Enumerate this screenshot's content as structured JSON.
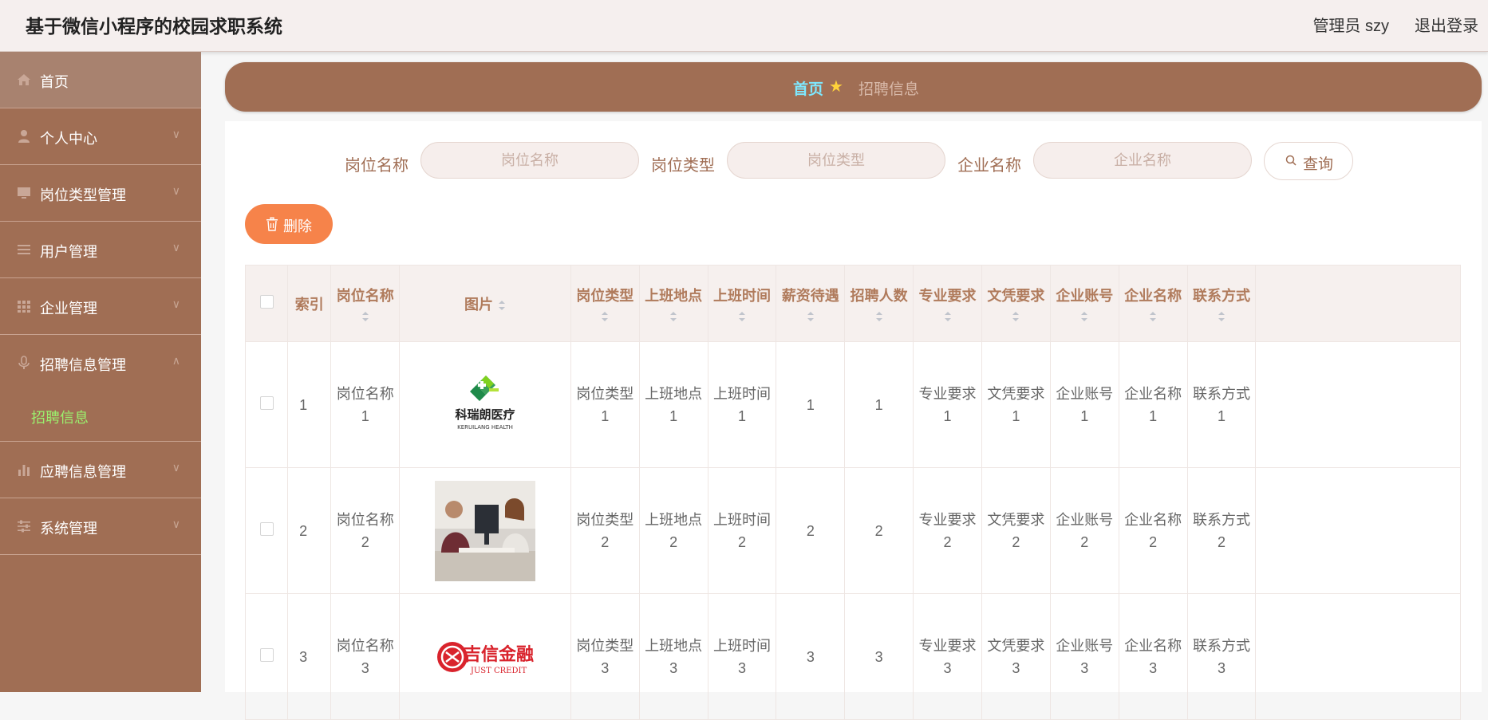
{
  "app": {
    "title": "基于微信小程序的校园求职系统"
  },
  "header": {
    "admin_label": "管理员 szy",
    "logout_label": "退出登录"
  },
  "sidebar": {
    "items": [
      {
        "label": "首页",
        "icon": "home-icon"
      },
      {
        "label": "个人中心",
        "icon": "user-icon"
      },
      {
        "label": "岗位类型管理",
        "icon": "monitor-icon"
      },
      {
        "label": "用户管理",
        "icon": "list-icon"
      },
      {
        "label": "企业管理",
        "icon": "grid-icon"
      },
      {
        "label": "招聘信息管理",
        "icon": "mic-icon"
      },
      {
        "label": "应聘信息管理",
        "icon": "bar-chart-icon"
      },
      {
        "label": "系统管理",
        "icon": "sliders-icon"
      }
    ],
    "submenu": {
      "label": "招聘信息"
    }
  },
  "breadcrumb": {
    "home": "首页",
    "current": "招聘信息"
  },
  "search": {
    "fields": [
      {
        "label": "岗位名称",
        "placeholder": "岗位名称"
      },
      {
        "label": "岗位类型",
        "placeholder": "岗位类型"
      },
      {
        "label": "企业名称",
        "placeholder": "企业名称"
      }
    ],
    "query_label": "查询"
  },
  "toolbar": {
    "delete_label": "删除"
  },
  "table": {
    "columns": [
      "索引",
      "岗位名称",
      "图片",
      "岗位类型",
      "上班地点",
      "上班时间",
      "薪资待遇",
      "招聘人数",
      "专业要求",
      "文凭要求",
      "企业账号",
      "企业名称",
      "联系方式"
    ],
    "rows": [
      {
        "index": "1",
        "job_name": [
          "岗位名称",
          "1"
        ],
        "image": {
          "brand": "科瑞朗医疗",
          "brand_en": "KERUILANG HEALTH"
        },
        "job_type": [
          "岗位类型",
          "1"
        ],
        "location": [
          "上班地点",
          "1"
        ],
        "work_time": [
          "上班时间",
          "1"
        ],
        "salary": "1",
        "headcount": "1",
        "major": [
          "专业要求",
          "1"
        ],
        "degree": [
          "文凭要求",
          "1"
        ],
        "company_account": [
          "企业账号",
          "1"
        ],
        "company_name": [
          "企业名称",
          "1"
        ],
        "contact": [
          "联系方式",
          "1"
        ]
      },
      {
        "index": "2",
        "job_name": [
          "岗位名称",
          "2"
        ],
        "image": {
          "brand": "",
          "brand_en": ""
        },
        "job_type": [
          "岗位类型",
          "2"
        ],
        "location": [
          "上班地点",
          "2"
        ],
        "work_time": [
          "上班时间",
          "2"
        ],
        "salary": "2",
        "headcount": "2",
        "major": [
          "专业要求",
          "2"
        ],
        "degree": [
          "文凭要求",
          "2"
        ],
        "company_account": [
          "企业账号",
          "2"
        ],
        "company_name": [
          "企业名称",
          "2"
        ],
        "contact": [
          "联系方式",
          "2"
        ]
      },
      {
        "index": "3",
        "job_name": [
          "岗位名称",
          "3"
        ],
        "image": {
          "brand": "吉信金融",
          "brand_en": "JUST CREDIT"
        },
        "job_type": [
          "岗位类型",
          "3"
        ],
        "location": [
          "上班地点",
          "3"
        ],
        "work_time": [
          "上班时间",
          "3"
        ],
        "salary": "3",
        "headcount": "3",
        "major": [
          "专业要求",
          "3"
        ],
        "degree": [
          "文凭要求",
          "3"
        ],
        "company_account": [
          "企业账号",
          "3"
        ],
        "company_name": [
          "企业名称",
          "3"
        ],
        "contact": [
          "联系方式",
          "3"
        ]
      }
    ]
  },
  "colors": {
    "brand": "#a06e54",
    "accent": "#f6834a",
    "active_sub": "#9bf06e",
    "crumb_home": "#7ee8ff"
  }
}
